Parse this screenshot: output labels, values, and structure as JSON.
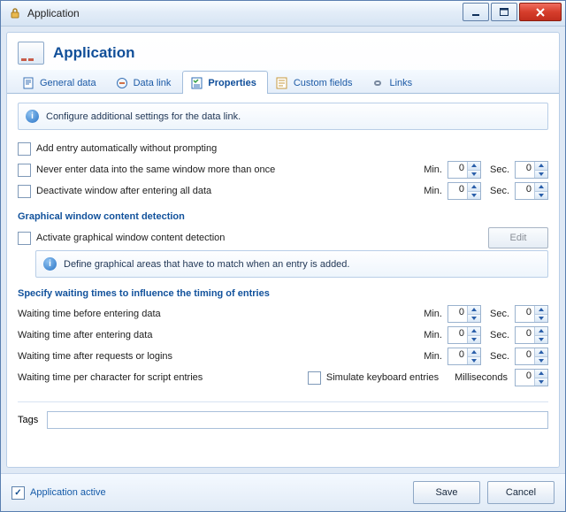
{
  "window": {
    "title": "Application"
  },
  "card": {
    "title": "Application"
  },
  "tabs": [
    {
      "id": "general",
      "label": "General data"
    },
    {
      "id": "datalink",
      "label": "Data link"
    },
    {
      "id": "properties",
      "label": "Properties"
    },
    {
      "id": "custom",
      "label": "Custom fields"
    },
    {
      "id": "links",
      "label": "Links"
    }
  ],
  "info": {
    "main": "Configure additional settings for the data link."
  },
  "opts": {
    "auto_add": {
      "label": "Add entry automatically without prompting",
      "checked": false
    },
    "never_same": {
      "label": "Never enter data into the same window more than once",
      "checked": false,
      "min": 0,
      "sec": 0
    },
    "deactivate": {
      "label": "Deactivate window after entering all data",
      "checked": false,
      "min": 0,
      "sec": 0
    }
  },
  "graphical": {
    "section": "Graphical window content detection",
    "activate": {
      "label": "Activate graphical window content detection",
      "checked": false
    },
    "edit": "Edit",
    "hint": "Define graphical areas that have to match when an entry is added."
  },
  "timing": {
    "section": "Specify waiting times to influence the timing of entries",
    "before": {
      "label": "Waiting time before entering data",
      "min": 0,
      "sec": 0
    },
    "after": {
      "label": "Waiting time after entering data",
      "min": 0,
      "sec": 0
    },
    "requests": {
      "label": "Waiting time after requests or logins",
      "min": 0,
      "sec": 0
    },
    "perchar": {
      "label": "Waiting time per character for script entries",
      "ms": 0
    },
    "simulate": {
      "label": "Simulate keyboard entries",
      "checked": false
    },
    "msLabel": "Milliseconds"
  },
  "units": {
    "min": "Min.",
    "sec": "Sec."
  },
  "tags": {
    "label": "Tags",
    "value": ""
  },
  "footer": {
    "active": {
      "label": "Application active",
      "checked": true
    },
    "save": "Save",
    "cancel": "Cancel"
  }
}
